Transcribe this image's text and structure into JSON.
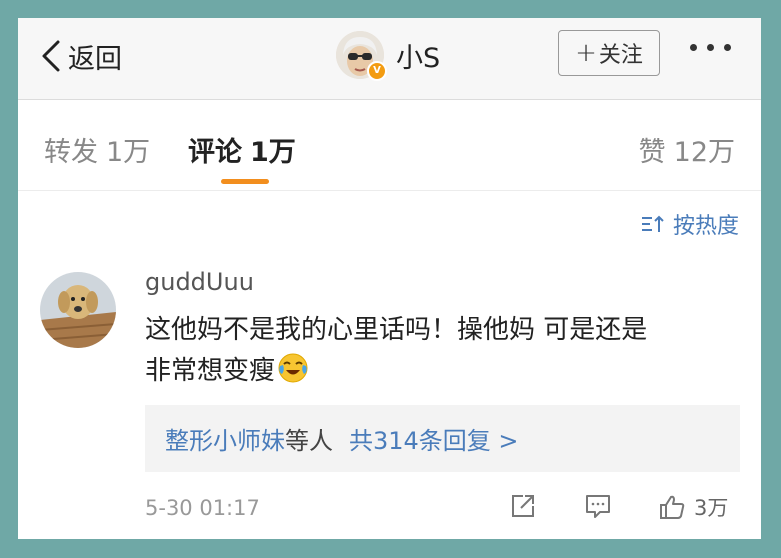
{
  "header": {
    "back_label": "返回",
    "profile_name": "小S",
    "verified_badge": "V",
    "follow_label": "关注"
  },
  "tabs": [
    {
      "label": "转发",
      "count": "1万",
      "active": false
    },
    {
      "label": "评论",
      "count": "1万",
      "active": true
    },
    {
      "label": "赞",
      "count": "12万",
      "active": false
    }
  ],
  "sort": {
    "label": "按热度",
    "icon": "sort-icon"
  },
  "comment": {
    "username": "guddUuu",
    "text_line1": "这他妈不是我的心里话吗！操他妈 可是还是",
    "text_line2": "非常想变瘦",
    "emoji": "crying-laughing-emoji",
    "replies": {
      "names": "整形小师妹",
      "suffix": "等人",
      "total": "共314条回复 >"
    },
    "timestamp": "5-30 01:17",
    "like_count": "3万"
  },
  "colors": {
    "accent": "#f28e1e",
    "link": "#4a7cba",
    "background": "#6fa8a6"
  }
}
